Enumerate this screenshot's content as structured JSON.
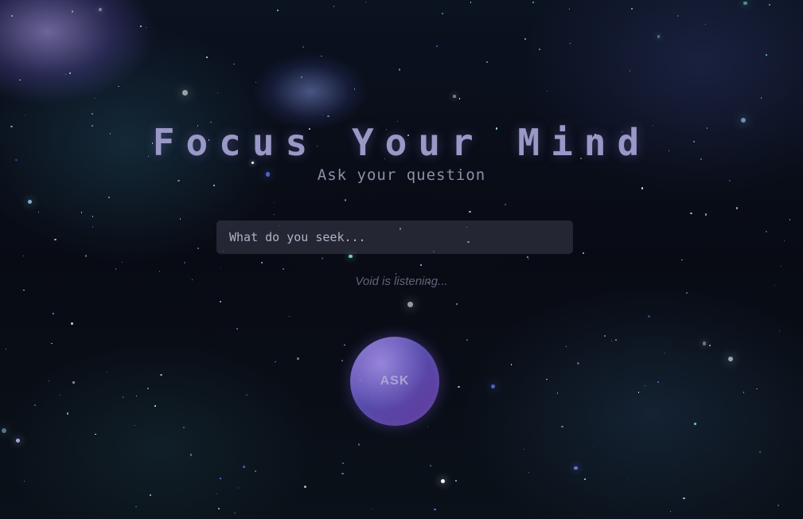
{
  "header": {
    "title": "Focus Your Mind",
    "subtitle": "Ask your question"
  },
  "query": {
    "placeholder": "What do you seek...",
    "value": ""
  },
  "status": {
    "text": "Void is listening..."
  },
  "actions": {
    "ask_label": "ASK"
  },
  "colors": {
    "title": "#9a98c6",
    "button_start": "#7a62c8",
    "button_end": "#6a3fa8",
    "background": "#080b14"
  }
}
